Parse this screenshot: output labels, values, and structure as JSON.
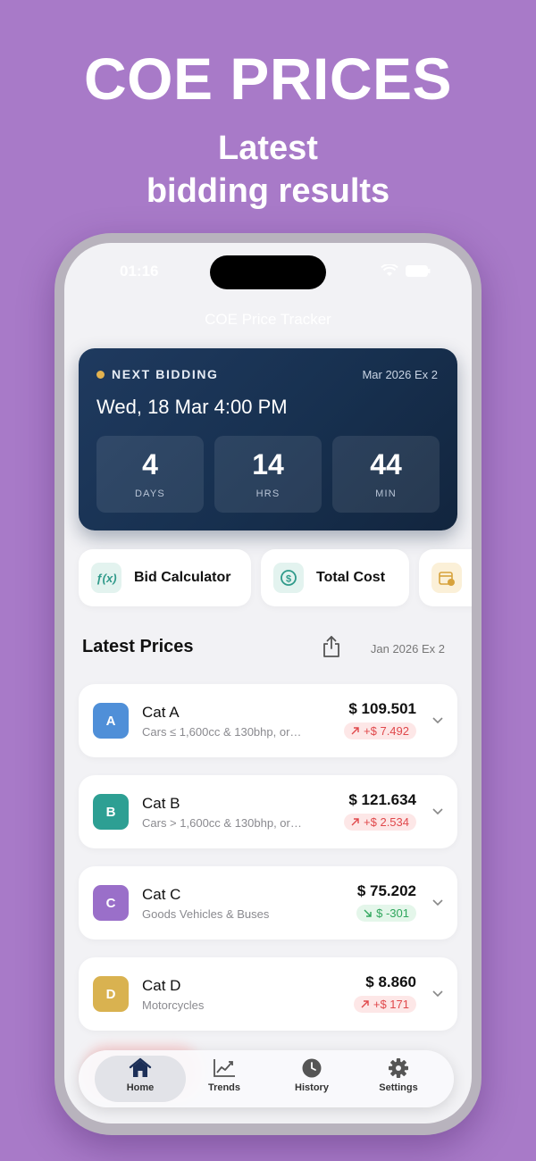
{
  "promo": {
    "title": "COE PRICES",
    "subtitle_line1": "Latest",
    "subtitle_line2": "bidding results"
  },
  "status_bar": {
    "time": "01:16"
  },
  "nav": {
    "title": "COE Price Tracker"
  },
  "next_bidding": {
    "label": "NEXT BIDDING",
    "round": "Mar 2026 Ex 2",
    "datetime": "Wed, 18 Mar 4:00 PM",
    "countdown": [
      {
        "value": "4",
        "unit": "DAYS"
      },
      {
        "value": "14",
        "unit": "HRS"
      },
      {
        "value": "44",
        "unit": "MIN"
      }
    ]
  },
  "quick_actions": [
    {
      "label": "Bid Calculator",
      "icon": "function-icon",
      "glyph": "ƒ(x)",
      "color": "#2f9a8a"
    },
    {
      "label": "Total Cost",
      "icon": "dollar-circle-icon",
      "glyph": "$",
      "color": "#2f9a8a"
    },
    {
      "label": "",
      "icon": "calendar-icon",
      "glyph": "",
      "color": "#d7a23c"
    }
  ],
  "latest_prices": {
    "title": "Latest Prices",
    "round": "Jan 2026 Ex 2",
    "categories": [
      {
        "badge": "A",
        "name": "Cat A",
        "desc": "Cars ≤ 1,600cc & 130bhp, or…",
        "price": "$ 109.501",
        "change": "+$ 7.492",
        "direction": "up",
        "color": "#4f8fd8"
      },
      {
        "badge": "B",
        "name": "Cat B",
        "desc": "Cars > 1,600cc & 130bhp, or…",
        "price": "$ 121.634",
        "change": "+$ 2.534",
        "direction": "up",
        "color": "#2d9f93"
      },
      {
        "badge": "C",
        "name": "Cat C",
        "desc": "Goods Vehicles & Buses",
        "price": "$ 75.202",
        "change": "$ -301",
        "direction": "down",
        "color": "#9a6fc9"
      },
      {
        "badge": "D",
        "name": "Cat D",
        "desc": "Motorcycles",
        "price": "$ 8.860",
        "change": "+$ 171",
        "direction": "up",
        "color": "#d9b250"
      }
    ]
  },
  "tabs": [
    {
      "label": "Home",
      "icon": "house-icon",
      "active": true
    },
    {
      "label": "Trends",
      "icon": "chart-line-icon",
      "active": false
    },
    {
      "label": "History",
      "icon": "clock-icon",
      "active": false
    },
    {
      "label": "Settings",
      "icon": "gear-icon",
      "active": false
    }
  ],
  "colors": {
    "background": "#a87ac8",
    "card_dark": "#1f3a5f",
    "accent_dot": "#e3b24f",
    "up": "#e0484b",
    "down": "#2fa65c"
  }
}
